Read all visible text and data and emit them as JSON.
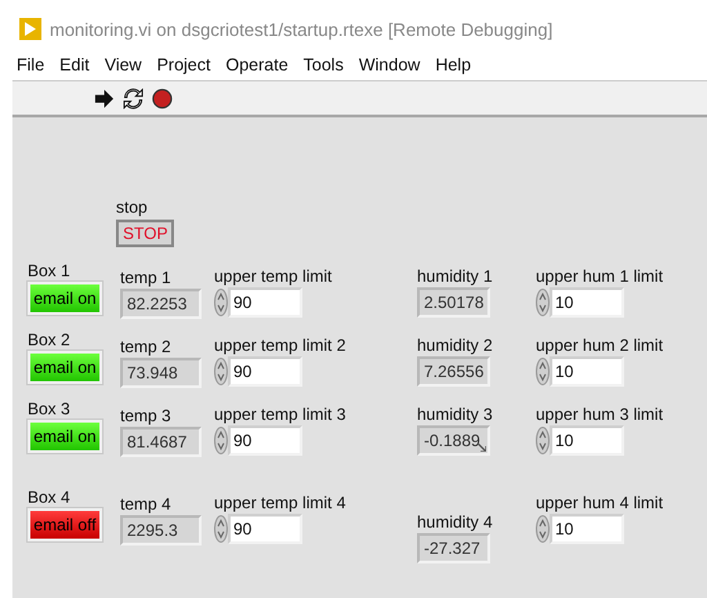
{
  "window": {
    "title": "monitoring.vi on dsgcriotest1/startup.rtexe [Remote Debugging]"
  },
  "menu": [
    "File",
    "Edit",
    "View",
    "Project",
    "Operate",
    "Tools",
    "Window",
    "Help"
  ],
  "stop": {
    "label": "stop",
    "button": "STOP"
  },
  "rows": [
    {
      "box": {
        "label": "Box 1",
        "led_text": "email on",
        "on": true
      },
      "temp": {
        "label": "temp 1",
        "value": "82.2253"
      },
      "temp_limit": {
        "label": "upper temp limit",
        "value": "90"
      },
      "humidity": {
        "label": "humidity 1",
        "value": "2.50178",
        "overflow": false
      },
      "hum_limit": {
        "label": "upper hum 1 limit",
        "value": "10"
      }
    },
    {
      "box": {
        "label": "Box 2",
        "led_text": "email on",
        "on": true
      },
      "temp": {
        "label": "temp 2",
        "value": "73.948"
      },
      "temp_limit": {
        "label": "upper temp limit 2",
        "value": "90"
      },
      "humidity": {
        "label": "humidity 2",
        "value": "7.26556",
        "overflow": false
      },
      "hum_limit": {
        "label": "upper hum 2 limit",
        "value": "10"
      }
    },
    {
      "box": {
        "label": "Box 3",
        "led_text": "email on",
        "on": true
      },
      "temp": {
        "label": "temp 3",
        "value": "81.4687"
      },
      "temp_limit": {
        "label": "upper temp limit 3",
        "value": "90"
      },
      "humidity": {
        "label": "humidity 3",
        "value": "-0.1889",
        "overflow": true
      },
      "hum_limit": {
        "label": "upper hum 3 limit",
        "value": "10"
      }
    },
    {
      "box": {
        "label": "Box 4",
        "led_text": "email off",
        "on": false
      },
      "temp": {
        "label": "temp 4",
        "value": "2295.3"
      },
      "temp_limit": {
        "label": "upper temp limit 4",
        "value": "90"
      },
      "humidity": {
        "label": "humidity 4",
        "value": "-27.327",
        "overflow": false
      },
      "hum_limit": {
        "label": "upper hum 4 limit",
        "value": "10"
      }
    }
  ]
}
